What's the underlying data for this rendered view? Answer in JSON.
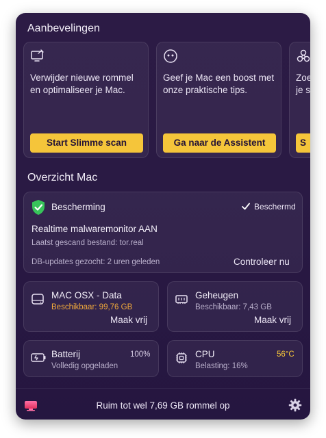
{
  "recommendations": {
    "title": "Aanbevelingen",
    "cards": [
      {
        "icon": "monitor-clean-icon",
        "text": "Verwijder nieuwe rommel en optimaliseer je Mac.",
        "button": "Start Slimme scan"
      },
      {
        "icon": "assistant-icon",
        "text": "Geef je Mac een boost met onze praktische tips.",
        "button": "Ga naar de Assistent"
      },
      {
        "icon": "biohazard-icon",
        "text": "Zoe je s",
        "button": "S"
      }
    ]
  },
  "overview": {
    "title": "Overzicht Mac",
    "protection": {
      "title": "Bescherming",
      "status": "Beschermd",
      "monitor": "Realtime malwaremonitor AAN",
      "last_scanned": "Laatst gescand bestand: tor.real",
      "db_updates": "DB-updates gezocht: 2 uren geleden",
      "action": "Controleer nu"
    },
    "disk": {
      "title": "MAC OSX - Data",
      "available": "Beschikbaar: 99,76 GB",
      "action": "Maak vrij"
    },
    "memory": {
      "title": "Geheugen",
      "available": "Beschikbaar: 7,43 GB",
      "action": "Maak vrij"
    },
    "battery": {
      "title": "Batterij",
      "percent": "100%",
      "status": "Volledig opgeladen"
    },
    "cpu": {
      "title": "CPU",
      "temp": "56°C",
      "load": "Belasting: 16%"
    }
  },
  "footer": {
    "text": "Ruim tot wel 7,69 GB rommel op"
  },
  "colors": {
    "accent": "#f5c53a",
    "shield": "#37c45a",
    "warning": "#f0a93b",
    "temp": "#f5c53a"
  }
}
